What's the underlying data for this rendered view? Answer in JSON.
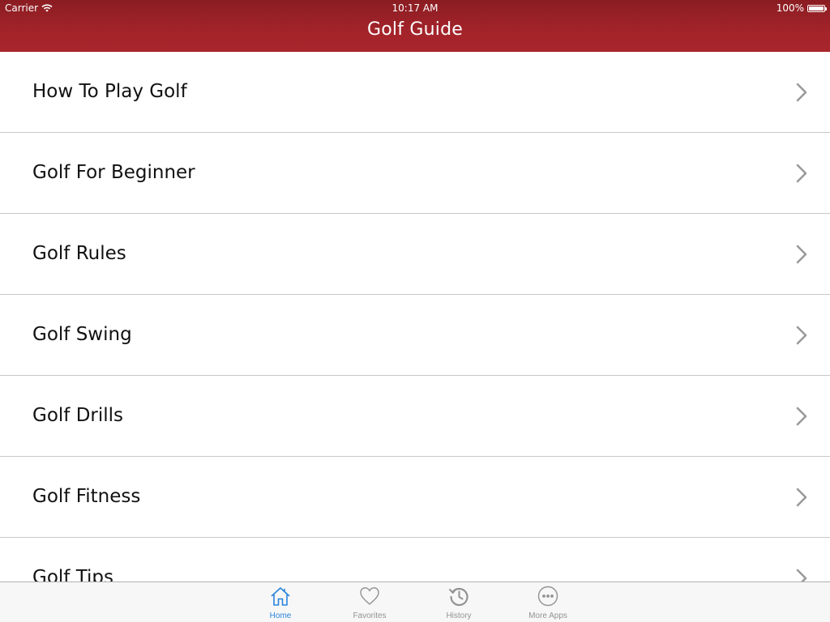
{
  "status_bar": {
    "carrier": "Carrier",
    "time": "10:17 AM",
    "battery": "100%"
  },
  "nav": {
    "title": "Golf Guide"
  },
  "list": {
    "items": [
      {
        "label": "How To Play Golf"
      },
      {
        "label": "Golf For Beginner"
      },
      {
        "label": "Golf Rules"
      },
      {
        "label": "Golf Swing"
      },
      {
        "label": "Golf Drills"
      },
      {
        "label": "Golf Fitness"
      },
      {
        "label": "Golf Tips"
      }
    ]
  },
  "tab_bar": {
    "active": "Home",
    "tabs": [
      {
        "label": "Home",
        "icon": "home-icon"
      },
      {
        "label": "Favorites",
        "icon": "heart-icon"
      },
      {
        "label": "History",
        "icon": "history-icon"
      },
      {
        "label": "More Apps",
        "icon": "more-icon"
      }
    ]
  },
  "colors": {
    "nav_bar": "#a3232a",
    "active_tab": "#2a83dc",
    "inactive_tab": "#929292",
    "separator": "#c8c8cc",
    "chevron": "#9a9a9a"
  }
}
